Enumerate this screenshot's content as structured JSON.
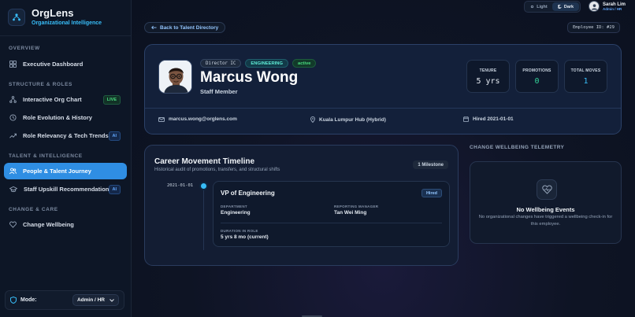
{
  "brand": {
    "name": "OrgLens",
    "tagline": "Organizational Intelligence"
  },
  "sidebar": {
    "sections": [
      {
        "label": "OVERVIEW"
      },
      {
        "label": "STRUCTURE & ROLES"
      },
      {
        "label": "TALENT & INTELLIGENCE"
      },
      {
        "label": "CHANGE & CARE"
      }
    ],
    "items": [
      {
        "label": "Executive Dashboard",
        "icon": "dashboard-icon"
      },
      {
        "label": "Interactive Org Chart",
        "icon": "org-chart-icon",
        "badge": "LIVE"
      },
      {
        "label": "Role Evolution & History",
        "icon": "history-icon"
      },
      {
        "label": "Role Relevancy & Tech Trends",
        "icon": "trend-icon",
        "badge": "AI"
      },
      {
        "label": "People & Talent Journey",
        "icon": "people-icon",
        "active": true
      },
      {
        "label": "Staff Upskill Recommendations",
        "icon": "graduation-cap-icon",
        "badge": "AI"
      },
      {
        "label": "Change Wellbeing",
        "icon": "heart-icon"
      }
    ],
    "mode": {
      "label": "Mode:",
      "value": "Admin / HR"
    }
  },
  "topbar": {
    "theme": {
      "light": "Light",
      "dark": "Dark",
      "selected": "Dark"
    },
    "user": {
      "name": "Sarah Lim",
      "role": "Admin / HR"
    }
  },
  "back_label": "Back to Talent Directory",
  "employee_id": "Employee ID: #29",
  "profile": {
    "level": "Director IC",
    "department": "ENGINEERING",
    "status": "active",
    "name": "Marcus Wong",
    "title": "Staff Member",
    "stats": [
      {
        "label": "TENURE",
        "value": "5 yrs",
        "color": "#e2e8f0"
      },
      {
        "label": "PROMOTIONS",
        "value": "0",
        "color": "#34d399"
      },
      {
        "label": "TOTAL MOVES",
        "value": "1",
        "color": "#38bdf8"
      }
    ],
    "email": "marcus.wong@orglens.com",
    "location": "Kuala Lumpur Hub (Hybrid)",
    "hired": "Hired 2021-01-01"
  },
  "timeline": {
    "title": "Career Movement Timeline",
    "subtitle": "Historical audit of promotions, transfers, and structural shifts",
    "count": "1 Milestone",
    "events": [
      {
        "date": "2021-01-01",
        "role": "VP of Engineering",
        "type": "Hired",
        "department_label": "DEPARTMENT",
        "department": "Engineering",
        "manager_label": "REPORTING MANAGER",
        "manager": "Tan Wei Ming",
        "duration_label": "DURATION IN ROLE",
        "duration": "5 yrs 8 mo (current)"
      }
    ]
  },
  "wellbeing": {
    "heading": "CHANGE WELLBEING TELEMETRY",
    "title": "No Wellbeing Events",
    "text": "No organizational changes have triggered a wellbeing check-in for this employee."
  }
}
